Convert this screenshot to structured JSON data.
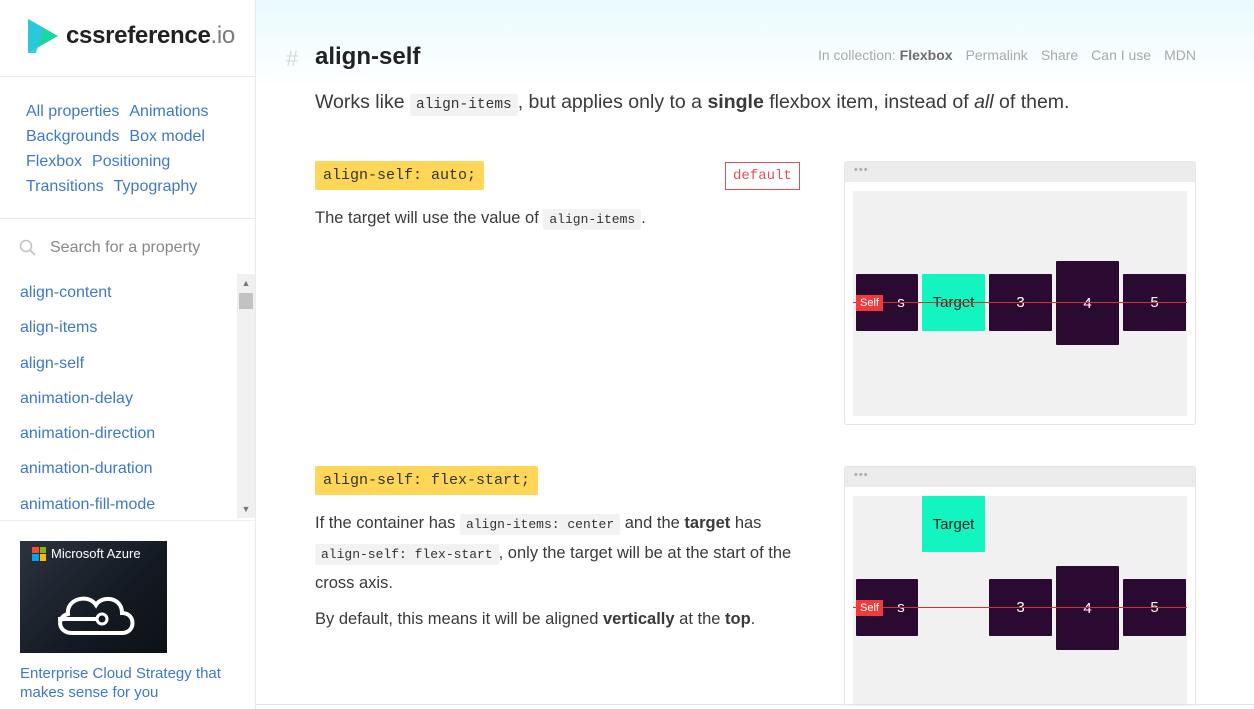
{
  "brand": {
    "name": "cssreference",
    "tld": ".io"
  },
  "categories": [
    "All properties",
    "Animations",
    "Backgrounds",
    "Box model",
    "Flexbox",
    "Positioning",
    "Transitions",
    "Typography"
  ],
  "search": {
    "placeholder": "Search for a property",
    "icon": "search-icon"
  },
  "properties": [
    "align-content",
    "align-items",
    "align-self",
    "animation-delay",
    "animation-direction",
    "animation-duration",
    "animation-fill-mode"
  ],
  "ad": {
    "brand": "Microsoft Azure",
    "text": "Enterprise Cloud Strategy that makes sense for you"
  },
  "header": {
    "hash": "#",
    "title": "align-self",
    "collection_prefix": "In collection:",
    "collection": "Flexbox",
    "links": [
      "Permalink",
      "Share",
      "Can I use",
      "MDN"
    ]
  },
  "intro": {
    "p1": "Works like ",
    "code1": "align-items",
    "p2": ", but applies only to a ",
    "strong1": "single",
    "p3": " flexbox item, instead of ",
    "em1": "all",
    "p4": " of them."
  },
  "examples": [
    {
      "declaration": "align-self: auto;",
      "badge": "default",
      "desc": {
        "t1": "The target will use the value of ",
        "c1": "align-items",
        "t2": "."
      },
      "demo": {
        "dots": "•••",
        "self_label": "Self",
        "items": [
          "s",
          "Target",
          "3",
          "4",
          "5"
        ]
      }
    },
    {
      "declaration": "align-self: flex-start;",
      "desc": {
        "t1": "If the container has ",
        "c1": "align-items: center",
        "t2": " and the ",
        "s1": "target",
        "t3": " has ",
        "c2": "align-self: flex-start",
        "t4": ", only the target will be at the start of the cross axis.",
        "t5": "By default, this means it will be aligned ",
        "s2": "vertically",
        "t6": " at the ",
        "s3": "top",
        "t7": "."
      },
      "demo": {
        "dots": "•••",
        "self_label": "Self",
        "items": [
          "s",
          "Target",
          "3",
          "4",
          "5"
        ]
      }
    }
  ],
  "colors": {
    "link": "#3f78c8",
    "declaration_bg": "#ffd758",
    "flex_item": "#2b0a31",
    "target": "#12f5c0",
    "badge": "#e05252"
  }
}
